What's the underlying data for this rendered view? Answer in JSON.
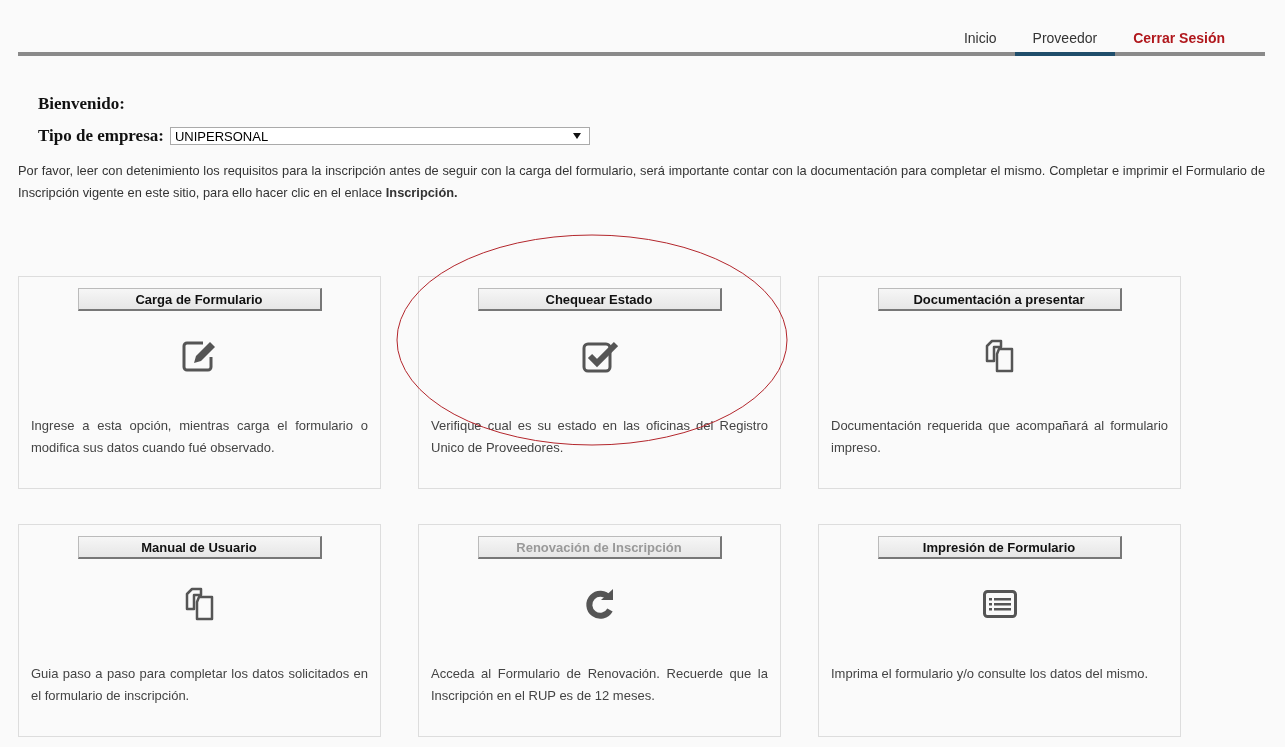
{
  "nav": {
    "items": [
      {
        "label": "Inicio",
        "kind": "plain",
        "selected": false
      },
      {
        "label": "Proveedor",
        "kind": "plain",
        "selected": true
      },
      {
        "label": "Cerrar Sesión",
        "kind": "logout",
        "selected": false
      }
    ]
  },
  "welcome": {
    "label": "Bienvenido:"
  },
  "company_type": {
    "label": "Tipo de empresa:",
    "value": "UNIPERSONAL"
  },
  "intro": "Por favor, leer con detenimiento los requisitos para la inscripción antes de seguir con la carga del formulario, será importante contar con la documentación para completar el mismo. Completar e imprimir el Formulario de Inscripción vigente en este sitio, para ello hacer clic en el enlace **Inscripción.**",
  "cards": [
    {
      "title": "Carga de Formulario",
      "kind": "edit",
      "disabled": false,
      "description": "Ingrese a esta opción, mientras carga el formulario o modifica sus datos cuando fué observado."
    },
    {
      "title": "Chequear Estado",
      "kind": "check",
      "disabled": false,
      "description": "Verifique cual es su estado en las oficinas del Registro Unico de Proveedores."
    },
    {
      "title": "Documentación a presentar",
      "kind": "copy",
      "disabled": false,
      "description": "Documentación requerida que acompañará al formulario impreso."
    },
    {
      "title": "Manual de Usuario",
      "kind": "copy",
      "disabled": false,
      "description": "Guia paso a paso para completar los datos solicitados en el formulario de inscripción."
    },
    {
      "title": "Renovación de Inscripción",
      "kind": "refresh",
      "disabled": true,
      "description": "Acceda al Formulario de Renovación. Recuerde que la Inscripción en el RUP es de 12 meses."
    },
    {
      "title": "Impresión de Formulario",
      "kind": "list",
      "disabled": false,
      "description": "Imprima el formulario y/o consulte los datos del mismo."
    }
  ]
}
